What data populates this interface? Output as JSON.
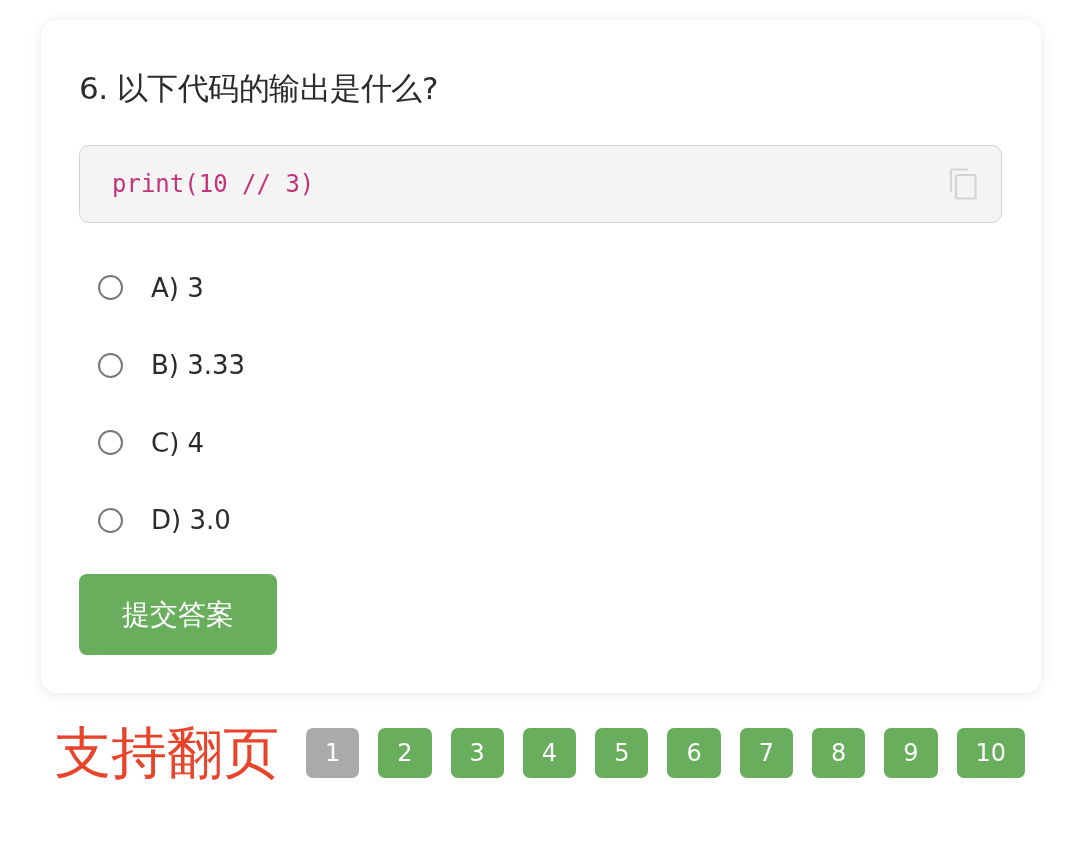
{
  "question": {
    "title": "6. 以下代码的输出是什么?"
  },
  "code_block": {
    "code": "print(10 // 3)"
  },
  "options": [
    {
      "label": "A) 3",
      "selected": false
    },
    {
      "label": "B) 3.33",
      "selected": false
    },
    {
      "label": "C) 4",
      "selected": false
    },
    {
      "label": "D) 3.0",
      "selected": false
    }
  ],
  "submit_button": {
    "label": "提交答案"
  },
  "annotation": "支持翻页",
  "pagination": [
    {
      "label": "1",
      "selected": true
    },
    {
      "label": "2",
      "selected": false
    },
    {
      "label": "3",
      "selected": false
    },
    {
      "label": "4",
      "selected": false
    },
    {
      "label": "5",
      "selected": false
    },
    {
      "label": "6",
      "selected": false
    },
    {
      "label": "7",
      "selected": false
    },
    {
      "label": "8",
      "selected": false
    },
    {
      "label": "9",
      "selected": false
    },
    {
      "label": "10",
      "selected": false
    }
  ]
}
